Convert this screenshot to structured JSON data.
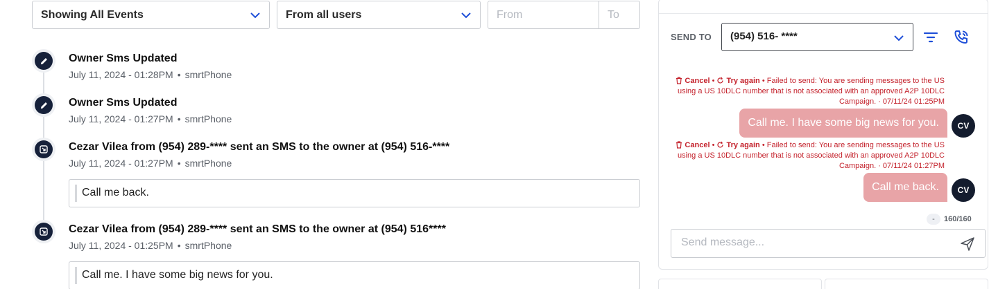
{
  "filters": {
    "event_filter": "Showing All Events",
    "user_filter": "From all users",
    "from_placeholder": "From",
    "to_placeholder": "To"
  },
  "events": [
    {
      "icon": "pencil-icon",
      "title": "Owner Sms Updated",
      "date": "July 11, 2024 - 01:28PM",
      "source": "smrtPhone"
    },
    {
      "icon": "pencil-icon",
      "title": "Owner Sms Updated",
      "date": "July 11, 2024 - 01:27PM",
      "source": "smrtPhone"
    },
    {
      "icon": "phone-sms-icon",
      "title": "Cezar Vilea from (954) 289-**** sent an SMS to the owner at (954) 516-****",
      "date": "July 11, 2024 - 01:27PM",
      "source": "smrtPhone",
      "message": "Call me back."
    },
    {
      "icon": "phone-sms-icon",
      "title": "Cezar Vilea from (954) 289-**** sent an SMS to the owner at (954) 516****",
      "date": "July 11, 2024 - 01:25PM",
      "source": "smrtPhone",
      "message": "Call me. I have some big news for you."
    }
  ],
  "sms_panel": {
    "send_to_label": "SEND TO",
    "send_to_value": "(954) 516- ****",
    "conversation": [
      {
        "cancel_label": "Cancel",
        "retry_label": "Try again",
        "error_text": "Failed to send: You are sending messages to the US using a US 10DLC number that is not associated with an approved A2P 10DLC Campaign. · 07/11/24 01:25PM",
        "message": "Call me. I have some big news for you.",
        "avatar": "CV"
      },
      {
        "cancel_label": "Cancel",
        "retry_label": "Try again",
        "error_text": "Failed to send: You are sending messages to the US using a US 10DLC number that is not associated with an approved A2P 10DLC Campaign. · 07/11/24 01:27PM",
        "message": "Call me back.",
        "avatar": "CV"
      }
    ],
    "segments": "-",
    "char_count": "160/160",
    "input_placeholder": "Send message..."
  },
  "colors": {
    "icon_dark": "#16213a",
    "accent_blue": "#1f4fd8",
    "error_red": "#c4222c",
    "bubble_failed": "#e8a4a7"
  }
}
